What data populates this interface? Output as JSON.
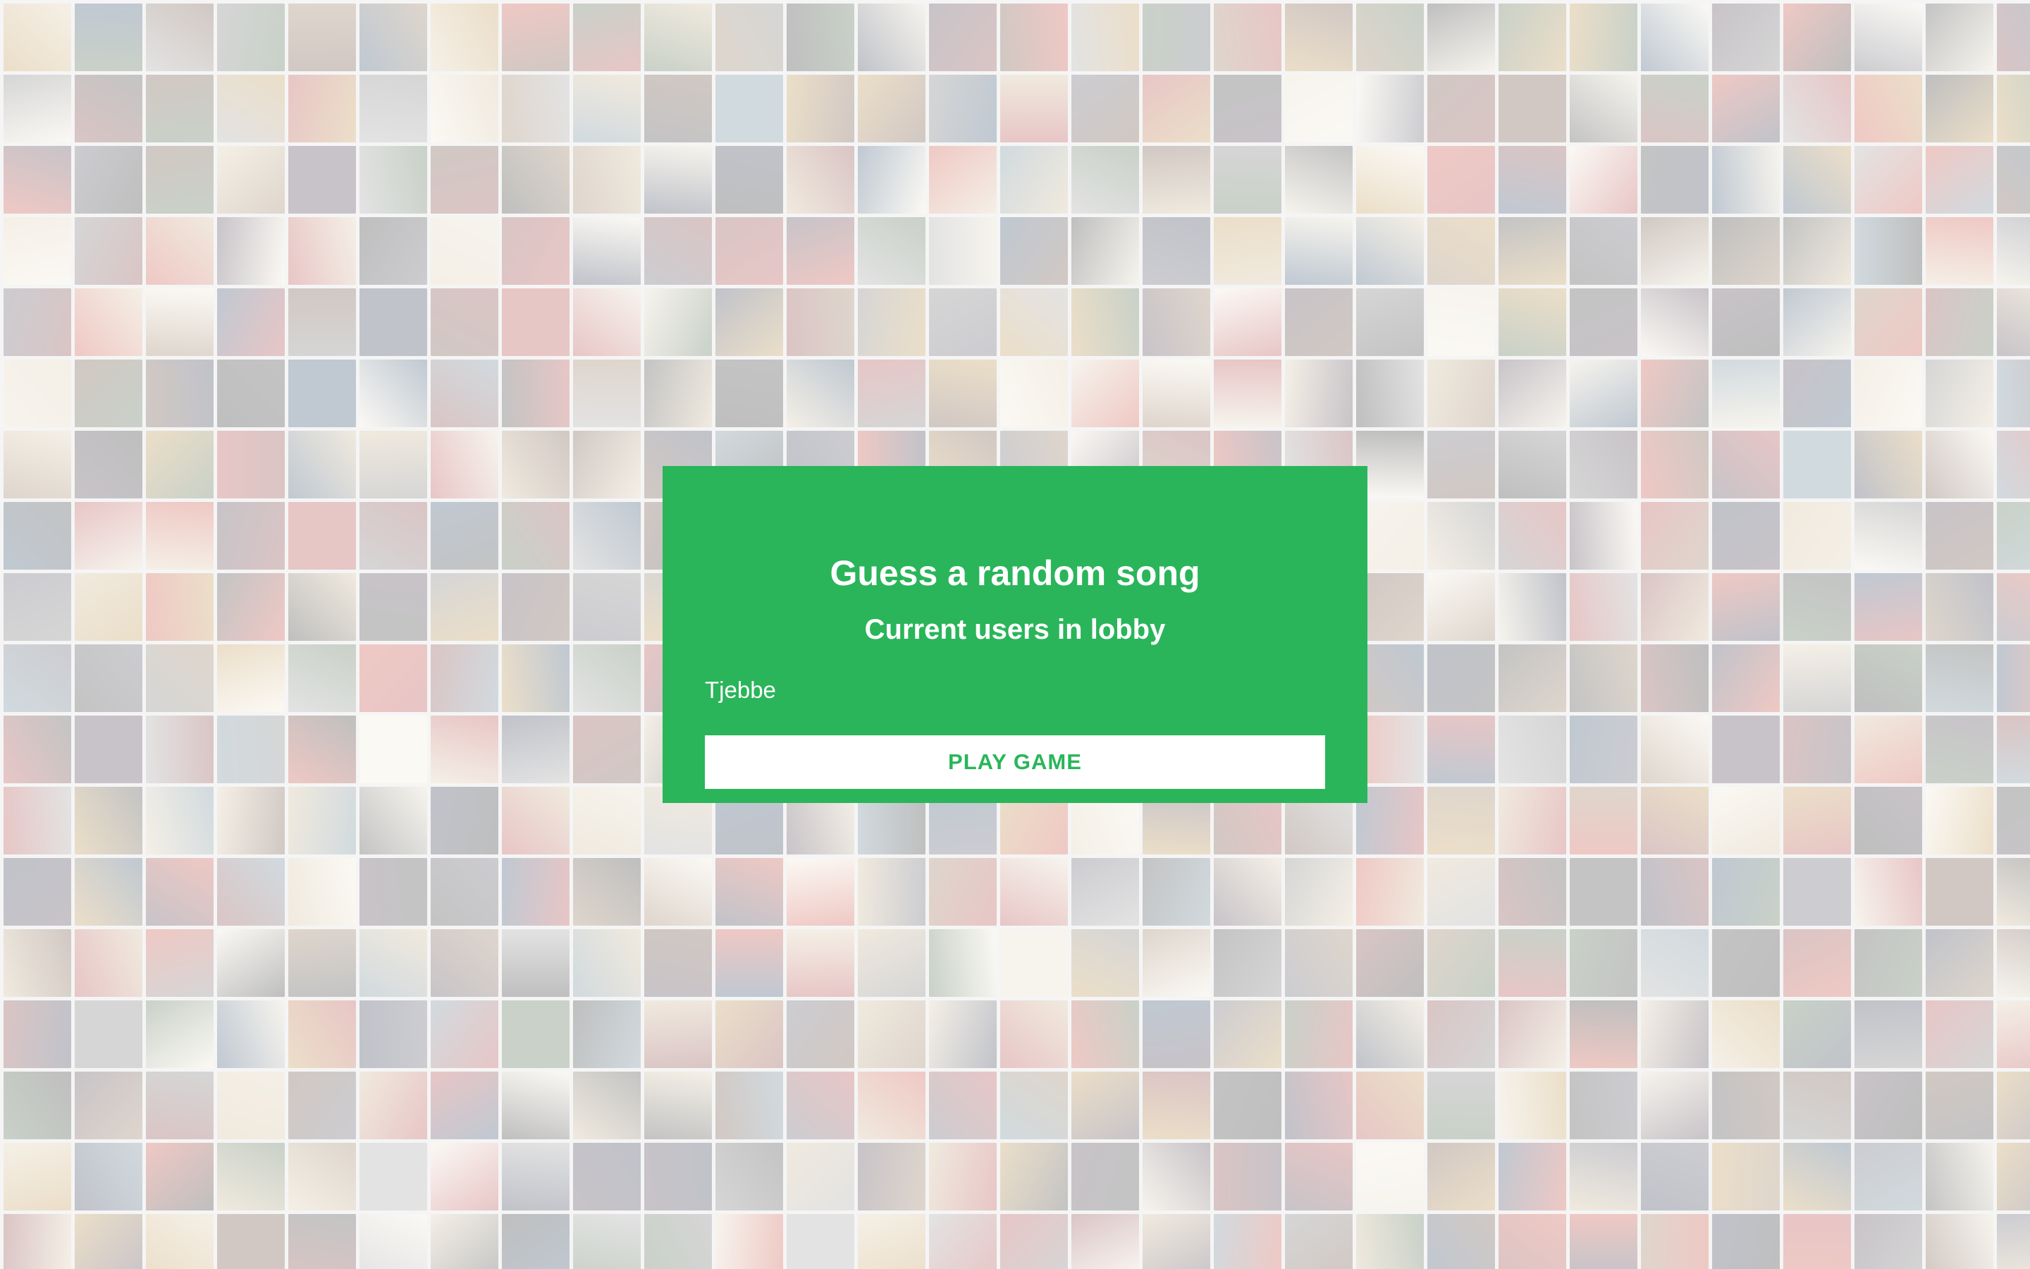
{
  "lobby": {
    "title": "Guess a random song",
    "subtitle": "Current users in lobby",
    "users": [
      "Tjebbe"
    ],
    "play_button_label": "PLAY GAME"
  },
  "theme": {
    "panel_color": "#2ab55a",
    "button_text_color": "#2ab55a",
    "button_background": "#ffffff",
    "text_color": "#ffffff"
  },
  "background": {
    "description_icon": "album-cover-mosaic"
  }
}
